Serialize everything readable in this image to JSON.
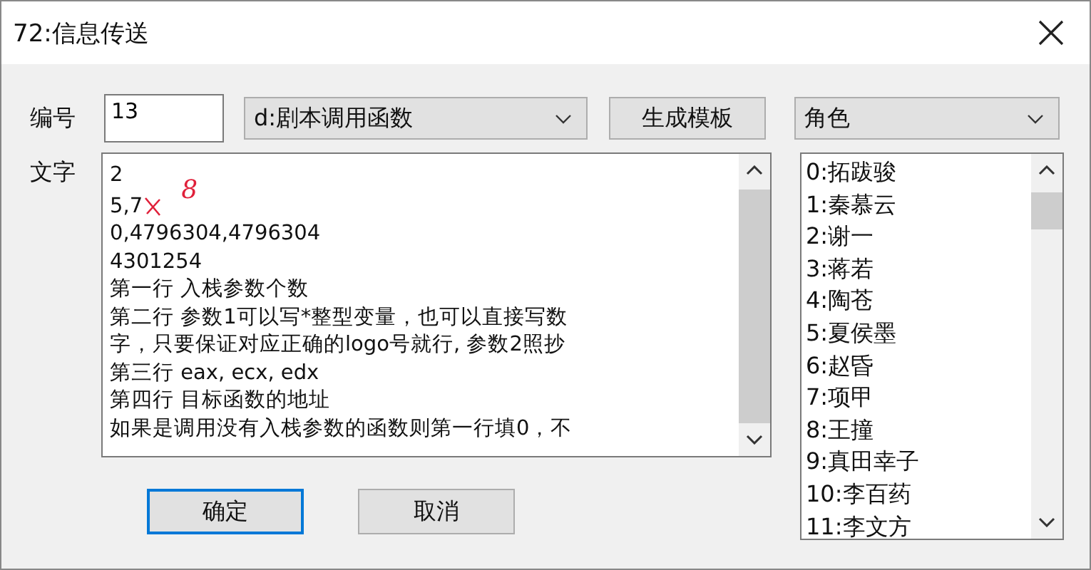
{
  "window": {
    "title": "72:信息传送"
  },
  "number": {
    "label": "编号",
    "value": "13"
  },
  "script_type": {
    "value": "d:剧本调用函数"
  },
  "generate_button": "生成模板",
  "category": {
    "value": "角色"
  },
  "text": {
    "label": "文字",
    "lines": [
      {
        "text": "2"
      },
      {
        "text": "5,7",
        "note": "8"
      },
      {
        "text": "0,4796304,4796304"
      },
      {
        "text": "4301254"
      },
      {
        "text": "第一行 入栈参数个数"
      },
      {
        "text": "第二行 参数1可以写*整型变量，也可以直接写数"
      },
      {
        "text": "字，只要保证对应正确的logo号就行, 参数2照抄"
      },
      {
        "text": "第三行 eax, ecx, edx"
      },
      {
        "text": "第四行 目标函数的地址"
      },
      {
        "text": "如果是调用没有入栈参数的函数则第一行填0，不"
      }
    ]
  },
  "list": {
    "items": [
      "0:拓跋骏",
      "1:秦慕云",
      "2:谢一",
      "3:蒋若",
      "4:陶苍",
      "5:夏侯墨",
      "6:赵昏",
      "7:项甲",
      "8:王撞",
      "9:真田幸子",
      "10:李百药",
      "11:李文方"
    ]
  },
  "buttons": [
    "确定",
    "取消"
  ]
}
